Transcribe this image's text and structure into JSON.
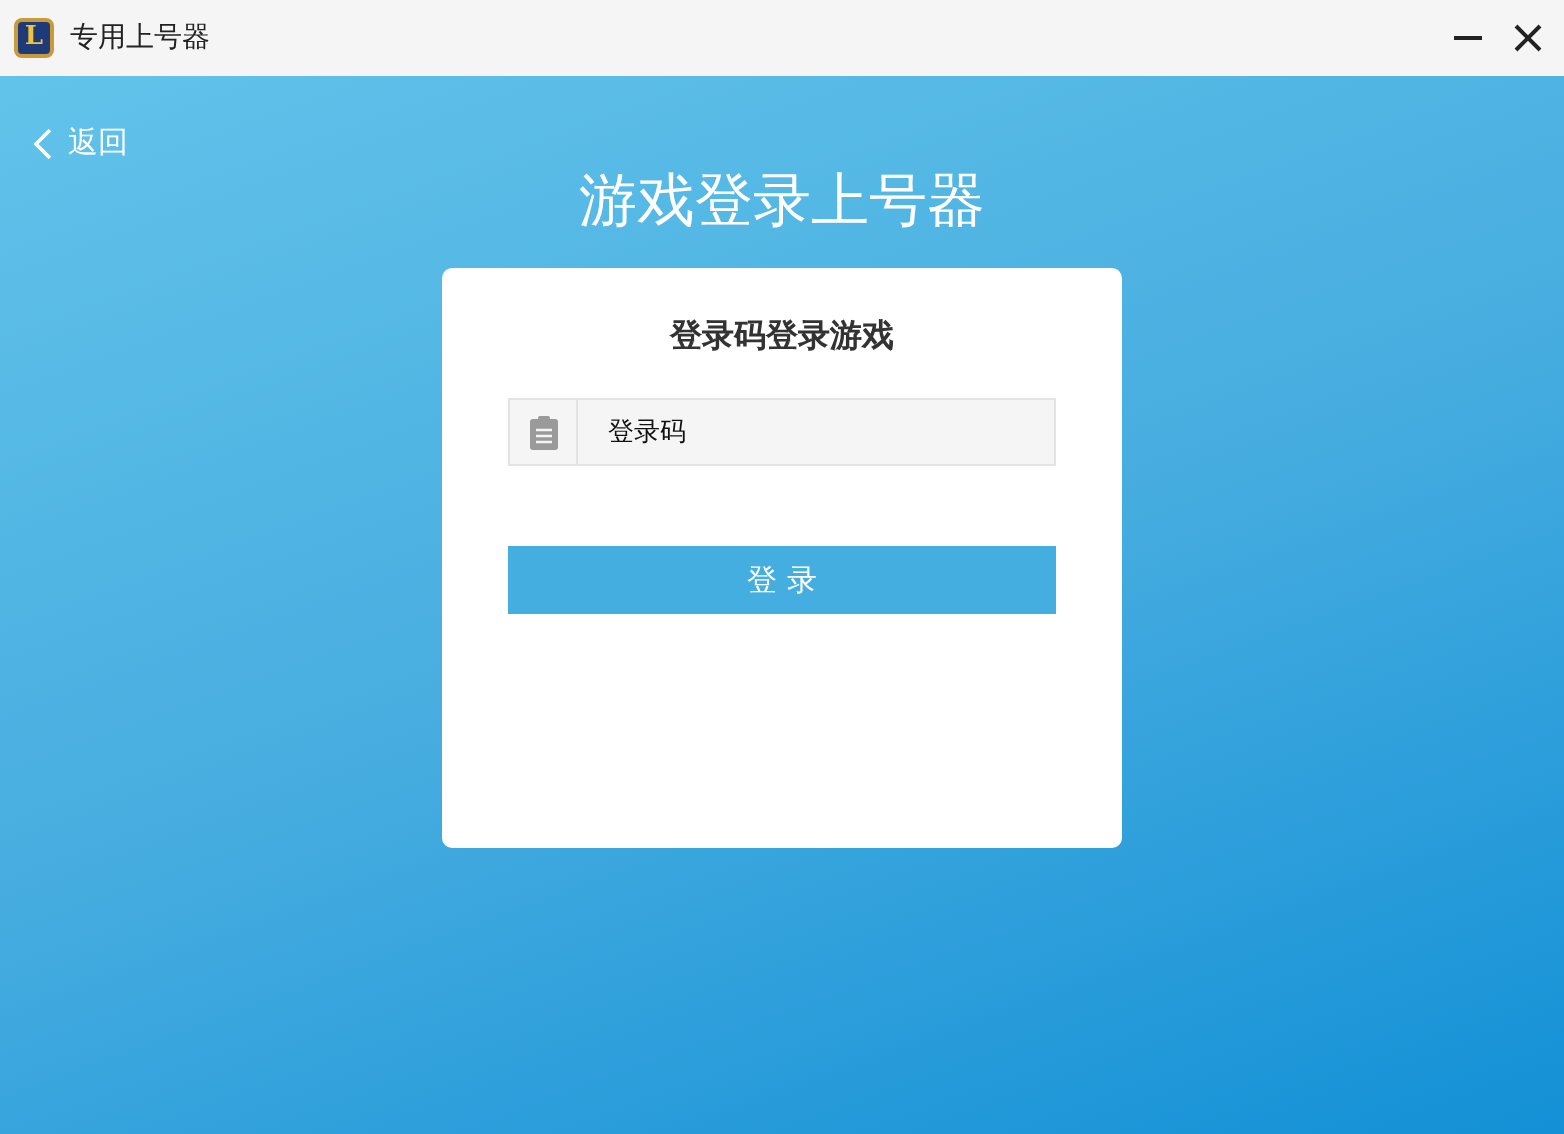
{
  "window": {
    "title": "专用上号器",
    "logo_letter": "L"
  },
  "back_link": {
    "label": "返回"
  },
  "heading": "游戏登录上号器",
  "card": {
    "title": "登录码登录游戏",
    "field": {
      "value": "登录码"
    },
    "button": "登 录"
  }
}
